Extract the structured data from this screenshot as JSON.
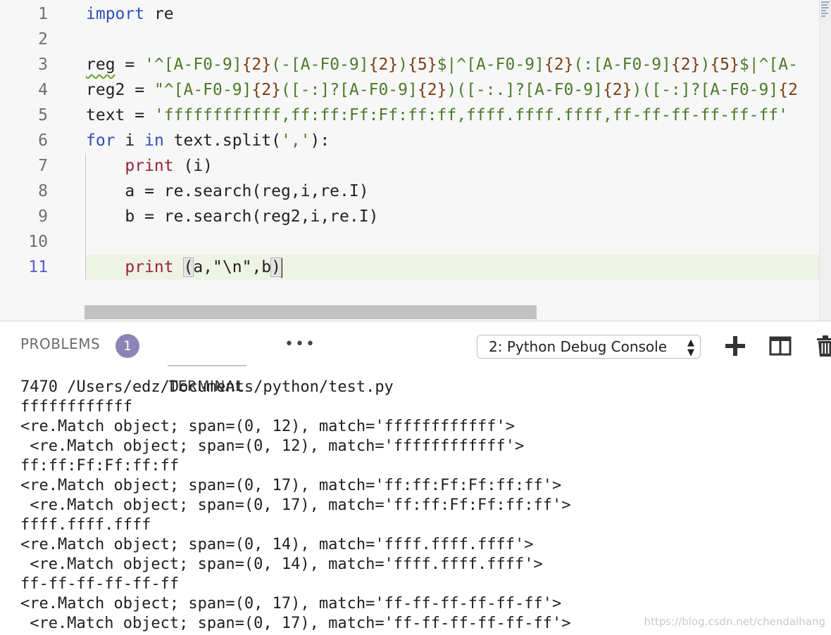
{
  "editor": {
    "line_numbers": [
      "1",
      "2",
      "3",
      "4",
      "5",
      "6",
      "7",
      "8",
      "9",
      "10",
      "11"
    ],
    "active_line": "11",
    "lines": {
      "l1": {
        "kw": "import",
        "rest": " re"
      },
      "l3": {
        "var": "reg",
        "eq": " = ",
        "s1": "'^[A-F0-9]",
        "b1": "{2}",
        "s2": "(-[A-F0-9]",
        "b2": "{2}",
        "s3": ")",
        "b3": "{5}",
        "s4": "$|^[A-F0-9]",
        "b4": "{2}",
        "s5": "(:[A-F0-9]",
        "b5": "{2}",
        "s6": ")",
        "b6": "{5}",
        "s7": "$|^[A-"
      },
      "l4": {
        "var": "reg2",
        "eq": " = ",
        "s1": "\"^[A-F0-9]",
        "b1": "{2}",
        "s2": "([-:]?[A-F0-9]",
        "b2": "{2}",
        "s3": ")([-:.]?[A-F0-9]",
        "b3": "{2}",
        "s4": ")([-:]?[A-F0-9]",
        "b4": "{2"
      },
      "l5": {
        "var": "text",
        "eq": " = ",
        "str": "'ffffffffffff,ff:ff:Ff:Ff:ff:ff,ffff.ffff.ffff,ff-ff-ff-ff-ff-ff'"
      },
      "l6": {
        "kw1": "for",
        "mid1": " i ",
        "kw2": "in",
        "mid2": " text.split(",
        "str": "','",
        "end": "):"
      },
      "l7": {
        "kw": "print",
        "rest": " (i)"
      },
      "l8": {
        "code": "a = re.search(reg,i,re.I)"
      },
      "l9": {
        "code": "b = re.search(reg2,i,re.I)"
      },
      "l11": {
        "kw": "print",
        "sp": " ",
        "open": "(",
        "mid": "a,\"\\n\",b",
        "close": ")"
      }
    }
  },
  "panel": {
    "tabs": {
      "problems": "PROBLEMS",
      "problems_count": "1",
      "terminal": "TERMINAL",
      "more": "•••"
    },
    "console_select": {
      "value": "2: Python Debug Console"
    },
    "icons": [
      "plus-icon",
      "split-editor-icon",
      "trash-icon"
    ],
    "terminal_lines": [
      "7470 /Users/edz/Documents/python/test.py",
      "ffffffffffff",
      "<re.Match object; span=(0, 12), match='ffffffffffff'>",
      " <re.Match object; span=(0, 12), match='ffffffffffff'>",
      "ff:ff:Ff:Ff:ff:ff",
      "<re.Match object; span=(0, 17), match='ff:ff:Ff:Ff:ff:ff'>",
      " <re.Match object; span=(0, 17), match='ff:ff:Ff:Ff:ff:ff'>",
      "ffff.ffff.ffff",
      "<re.Match object; span=(0, 14), match='ffff.ffff.ffff'>",
      " <re.Match object; span=(0, 14), match='ffff.ffff.ffff'>",
      "ff-ff-ff-ff-ff-ff",
      "<re.Match object; span=(0, 17), match='ff-ff-ff-ff-ff-ff'>",
      " <re.Match object; span=(0, 17), match='ff-ff-ff-ff-ff-ff'>"
    ]
  },
  "watermark": "https://blog.csdn.net/chendaihang",
  "colors": {
    "keyword_blue": "#2f4fb8",
    "keyword_red": "#9b2335",
    "string_green": "#4d7a2a",
    "badge": "#8c84b4",
    "current_line": "#eef3e4"
  }
}
